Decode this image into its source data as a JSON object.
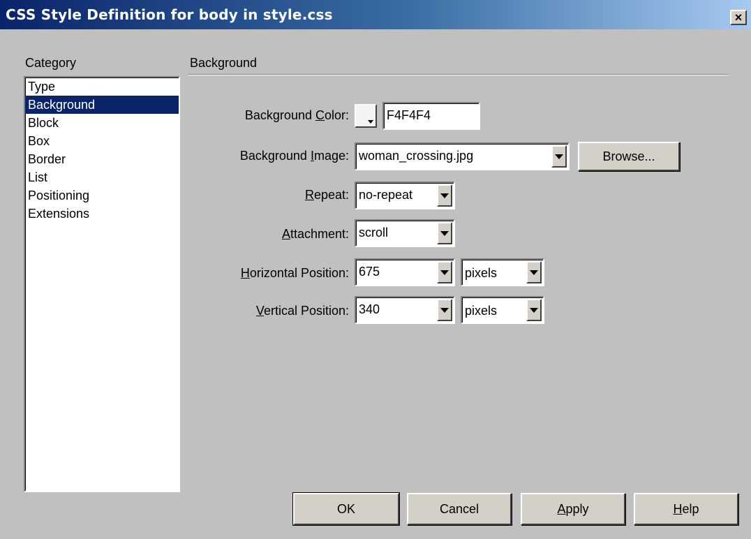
{
  "window": {
    "title": "CSS Style Definition for body in style.css",
    "close_glyph": "×"
  },
  "category": {
    "label": "Category",
    "items": [
      "Type",
      "Background",
      "Block",
      "Box",
      "Border",
      "List",
      "Positioning",
      "Extensions"
    ],
    "selected": "Background"
  },
  "panel": {
    "title": "Background",
    "background_color": {
      "label_pre": "Background ",
      "label_key": "C",
      "label_post": "olor:",
      "swatch_color": "#F4F4F4",
      "value": "F4F4F4"
    },
    "background_image": {
      "label_pre": "Background ",
      "label_key": "I",
      "label_post": "mage:",
      "value": "woman_crossing.jpg",
      "browse_label": "Browse..."
    },
    "repeat": {
      "label_pre": "",
      "label_key": "R",
      "label_post": "epeat:",
      "value": "no-repeat"
    },
    "attachment": {
      "label_pre": "",
      "label_key": "A",
      "label_post": "ttachment:",
      "value": "scroll"
    },
    "horizontal_position": {
      "label_pre": "",
      "label_key": "H",
      "label_post": "orizontal Position:",
      "value": "675",
      "unit": "pixels"
    },
    "vertical_position": {
      "label_pre": "",
      "label_key": "V",
      "label_post": "ertical Position:",
      "value": "340",
      "unit": "pixels"
    }
  },
  "buttons": {
    "ok": "OK",
    "cancel": "Cancel",
    "apply_key": "A",
    "apply_rest": "pply",
    "help_key": "H",
    "help_rest": "elp"
  },
  "colors": {
    "dialog_bg": "#c0c0c0",
    "title_active": "#0a246a",
    "selection": "#0a246a"
  }
}
